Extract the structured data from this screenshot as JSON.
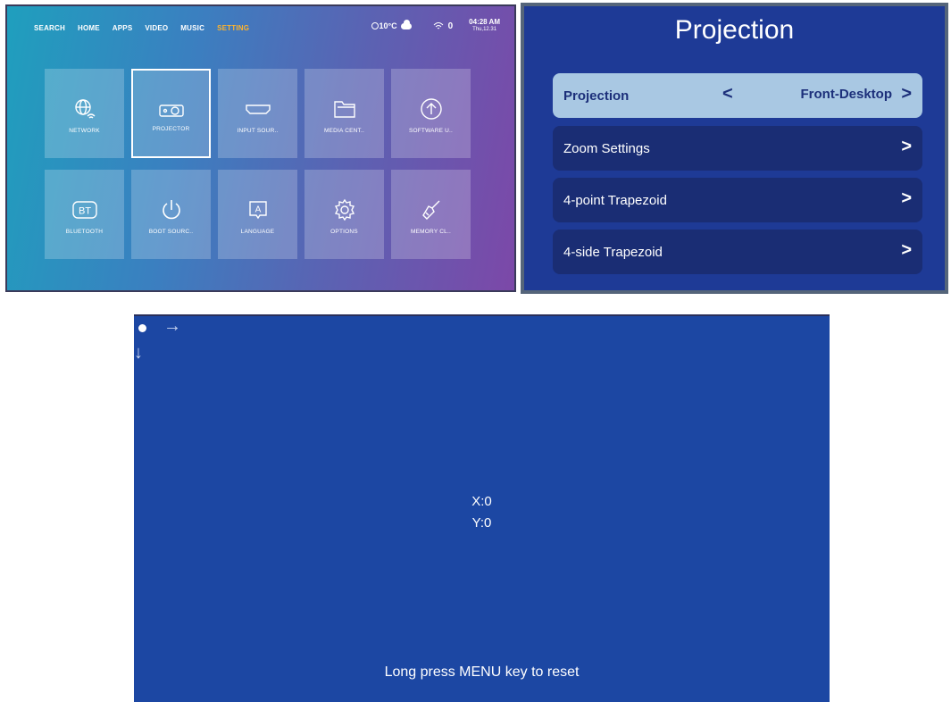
{
  "settings_screen": {
    "nav": [
      "SEARCH",
      "HOME",
      "APPS",
      "VIDEO",
      "MUSIC",
      "SETTING"
    ],
    "active_nav": "SETTING",
    "weather": "10°C",
    "wifi_count": "0",
    "time": "04:28 AM",
    "date": "Thu,12.31",
    "tiles": [
      {
        "label": "NETWORK",
        "icon": "globe-wifi-icon"
      },
      {
        "label": "PROJECTOR",
        "icon": "projector-icon"
      },
      {
        "label": "INPUT SOUR..",
        "icon": "hdmi-icon"
      },
      {
        "label": "MEDIA CENT..",
        "icon": "folder-icon"
      },
      {
        "label": "SOFTWARE U..",
        "icon": "upload-circle-icon"
      },
      {
        "label": "BLUETOOTH",
        "icon": "bt-icon"
      },
      {
        "label": "BOOT SOURC..",
        "icon": "power-icon"
      },
      {
        "label": "LANGUAGE",
        "icon": "language-icon"
      },
      {
        "label": "OPTIONS",
        "icon": "gear-icon"
      },
      {
        "label": "MEMORY CL..",
        "icon": "broom-icon"
      }
    ]
  },
  "projection_menu": {
    "title": "Projection",
    "rows": [
      {
        "label": "Projection",
        "value": "Front-Desktop"
      },
      {
        "label": "Zoom Settings"
      },
      {
        "label": "4-point Trapezoid"
      },
      {
        "label": "4-side Trapezoid"
      }
    ]
  },
  "shift_screen": {
    "x_text": "X:0",
    "y_text": "Y:0",
    "hint": "Long press MENU key to reset"
  }
}
